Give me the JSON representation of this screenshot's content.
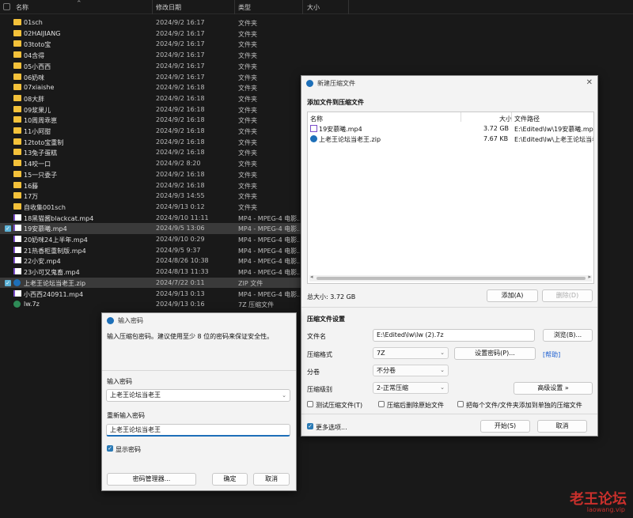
{
  "explorer": {
    "headers": {
      "name": "名称",
      "modified": "修改日期",
      "type": "类型",
      "size": "大小"
    },
    "rows": [
      {
        "name": "01sch",
        "date": "2024/9/2 16:17",
        "type": "文件夹",
        "kind": "folder",
        "selected": false
      },
      {
        "name": "02HAIJIANG",
        "date": "2024/9/2 16:17",
        "type": "文件夹",
        "kind": "folder",
        "selected": false
      },
      {
        "name": "03toto宝",
        "date": "2024/9/2 16:17",
        "type": "文件夹",
        "kind": "folder",
        "selected": false
      },
      {
        "name": "04含得",
        "date": "2024/9/2 16:17",
        "type": "文件夹",
        "kind": "folder",
        "selected": false
      },
      {
        "name": "05小西西",
        "date": "2024/9/2 16:17",
        "type": "文件夹",
        "kind": "folder",
        "selected": false
      },
      {
        "name": "06奶咪",
        "date": "2024/9/2 16:17",
        "type": "文件夹",
        "kind": "folder",
        "selected": false
      },
      {
        "name": "07xiaishe",
        "date": "2024/9/2 16:18",
        "type": "文件夹",
        "kind": "folder",
        "selected": false
      },
      {
        "name": "08大胖",
        "date": "2024/9/2 16:18",
        "type": "文件夹",
        "kind": "folder",
        "selected": false
      },
      {
        "name": "09浆果儿",
        "date": "2024/9/2 16:18",
        "type": "文件夹",
        "kind": "folder",
        "selected": false
      },
      {
        "name": "10周周乖崽",
        "date": "2024/9/2 16:18",
        "type": "文件夹",
        "kind": "folder",
        "selected": false
      },
      {
        "name": "11小阿甜",
        "date": "2024/9/2 16:18",
        "type": "文件夹",
        "kind": "folder",
        "selected": false
      },
      {
        "name": "12toto宝重制",
        "date": "2024/9/2 16:18",
        "type": "文件夹",
        "kind": "folder",
        "selected": false
      },
      {
        "name": "13兔子蛋糕",
        "date": "2024/9/2 16:18",
        "type": "文件夹",
        "kind": "folder",
        "selected": false
      },
      {
        "name": "14咬一口",
        "date": "2024/9/2 8:20",
        "type": "文件夹",
        "kind": "folder",
        "selected": false
      },
      {
        "name": "15一只委子",
        "date": "2024/9/2 16:18",
        "type": "文件夹",
        "kind": "folder",
        "selected": false
      },
      {
        "name": "16藤",
        "date": "2024/9/2 16:18",
        "type": "文件夹",
        "kind": "folder",
        "selected": false
      },
      {
        "name": "17万",
        "date": "2024/9/3 14:55",
        "type": "文件夹",
        "kind": "folder",
        "selected": false
      },
      {
        "name": "自收集001sch",
        "date": "2024/9/13 0:12",
        "type": "文件夹",
        "kind": "folder",
        "selected": false
      },
      {
        "name": "18黑猫酱blackcat.mp4",
        "date": "2024/9/10 11:11",
        "type": "MP4 - MPEG-4 电影...",
        "kind": "mp4",
        "selected": false
      },
      {
        "name": "19安慕曦.mp4",
        "date": "2024/9/5 13:06",
        "type": "MP4 - MPEG-4 电影...",
        "kind": "mp4",
        "selected": true
      },
      {
        "name": "20奶咪24上半年.mp4",
        "date": "2024/9/10 0:29",
        "type": "MP4 - MPEG-4 电影...",
        "kind": "mp4",
        "selected": false
      },
      {
        "name": "21热香柜重制版.mp4",
        "date": "2024/9/5 9:37",
        "type": "MP4 - MPEG-4 电影...",
        "kind": "mp4",
        "selected": false
      },
      {
        "name": "22小安.mp4",
        "date": "2024/8/26 10:38",
        "type": "MP4 - MPEG-4 电影...",
        "kind": "mp4",
        "selected": false
      },
      {
        "name": "23小可又鬼畜.mp4",
        "date": "2024/8/13 11:33",
        "type": "MP4 - MPEG-4 电影...",
        "kind": "mp4",
        "selected": false
      },
      {
        "name": "上老王论坛当老王.zip",
        "date": "2024/7/22 0:11",
        "type": "ZIP 文件",
        "kind": "zip",
        "selected": true
      },
      {
        "name": "小西西240911.mp4",
        "date": "2024/9/13 0:13",
        "type": "MP4 - MPEG-4 电影...",
        "kind": "mp4",
        "selected": false
      },
      {
        "name": "lw.7z",
        "date": "2024/9/13 0:16",
        "type": "7Z 压缩文件",
        "kind": "z7",
        "selected": false
      }
    ]
  },
  "archive_dialog": {
    "title": "新建压缩文件",
    "section_add": "添加文件到压缩文件",
    "list_headers": {
      "name": "名称",
      "size": "大小",
      "path": "文件路径"
    },
    "files": [
      {
        "name": "19安慕曦.mp4",
        "size": "3.72 GB",
        "path": "E:\\Edited\\lw\\19安慕曦.mp4",
        "kind": "mp4"
      },
      {
        "name": "上老王论坛当老王.zip",
        "size": "7.67 KB",
        "path": "E:\\Edited\\lw\\上老王论坛当老",
        "kind": "zip"
      }
    ],
    "total": "总大小: 3.72 GB",
    "add_button": "添加(A)",
    "remove_button": "删除(D)",
    "settings_title": "压缩文件设置",
    "filename_label": "文件名",
    "filename_value": "E:\\Edited\\lw\\lw (2).7z",
    "browse_button": "浏览(B)...",
    "format_label": "压缩格式",
    "format_value": "7Z",
    "set_password_button": "设置密码(P)...",
    "help_link": "[帮助]",
    "split_label": "分卷",
    "split_value": "不分卷",
    "level_label": "压缩级别",
    "level_value": "2-正常压缩",
    "advanced_button": "高级设置 »",
    "opt_test": "测试压缩文件(T)",
    "opt_delete": "压缩后删除原始文件",
    "opt_each": "把每个文件/文件夹添加到单独的压缩文件",
    "more_options": "更多选项...",
    "start_button": "开始(S)",
    "cancel_button": "取消"
  },
  "password_dialog": {
    "title": "输入密码",
    "description": "输入压缩包密码。建议使用至少 8 位的密码来保证安全性。",
    "password_label": "输入密码",
    "password_value": "上老王论坛当老王",
    "confirm_label": "重新输入密码",
    "confirm_value": "上老王论坛当老王",
    "show_password": "显示密码",
    "manager_button": "密码管理器...",
    "ok_button": "确定",
    "cancel_button": "取消"
  },
  "watermark": {
    "line1": "老王论坛",
    "line2": "laowang.vip"
  },
  "colors": {
    "accent": "#1d6fb8",
    "folder": "#f3c13a",
    "watermark": "#c9302c"
  }
}
